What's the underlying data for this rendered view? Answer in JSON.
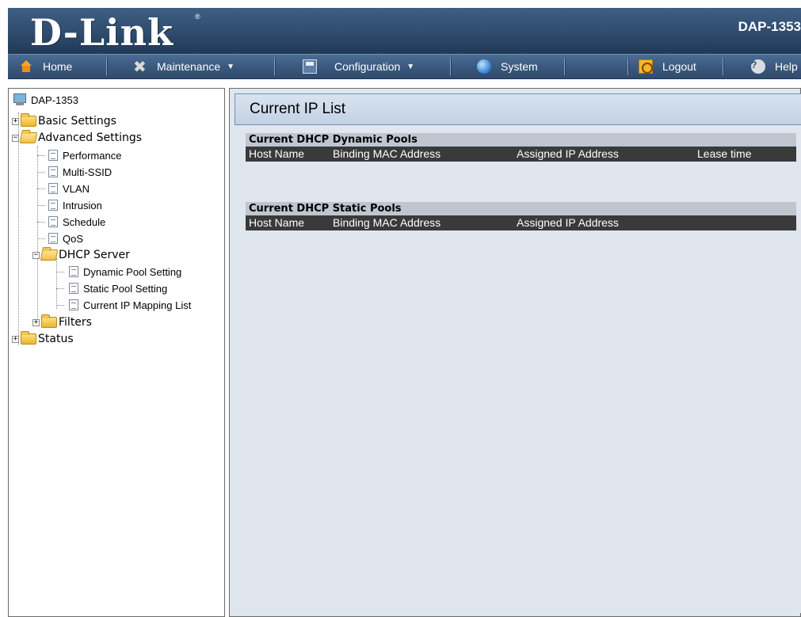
{
  "header": {
    "logo": "D-Link",
    "logo_reg": "®",
    "model": "DAP-1353"
  },
  "menu": {
    "home": "Home",
    "maintenance": "Maintenance",
    "configuration": "Configuration",
    "system": "System",
    "logout": "Logout",
    "help": "Help"
  },
  "tree": {
    "root": "DAP-1353",
    "basic": "Basic Settings",
    "advanced": "Advanced Settings",
    "performance": "Performance",
    "multissid": "Multi-SSID",
    "vlan": "VLAN",
    "intrusion": "Intrusion",
    "schedule": "Schedule",
    "qos": "QoS",
    "dhcp": "DHCP Server",
    "dynamic_pool": "Dynamic Pool Setting",
    "static_pool": "Static Pool Setting",
    "current_ip": "Current IP Mapping List",
    "filters": "Filters",
    "status": "Status"
  },
  "content": {
    "title": "Current IP List",
    "dynamic": {
      "heading": "Current DHCP Dynamic Pools",
      "columns": [
        "Host Name",
        "Binding MAC Address",
        "Assigned IP Address",
        "Lease time"
      ]
    },
    "static": {
      "heading": "Current DHCP Static Pools",
      "columns": [
        "Host Name",
        "Binding MAC Address",
        "Assigned IP Address"
      ]
    }
  }
}
